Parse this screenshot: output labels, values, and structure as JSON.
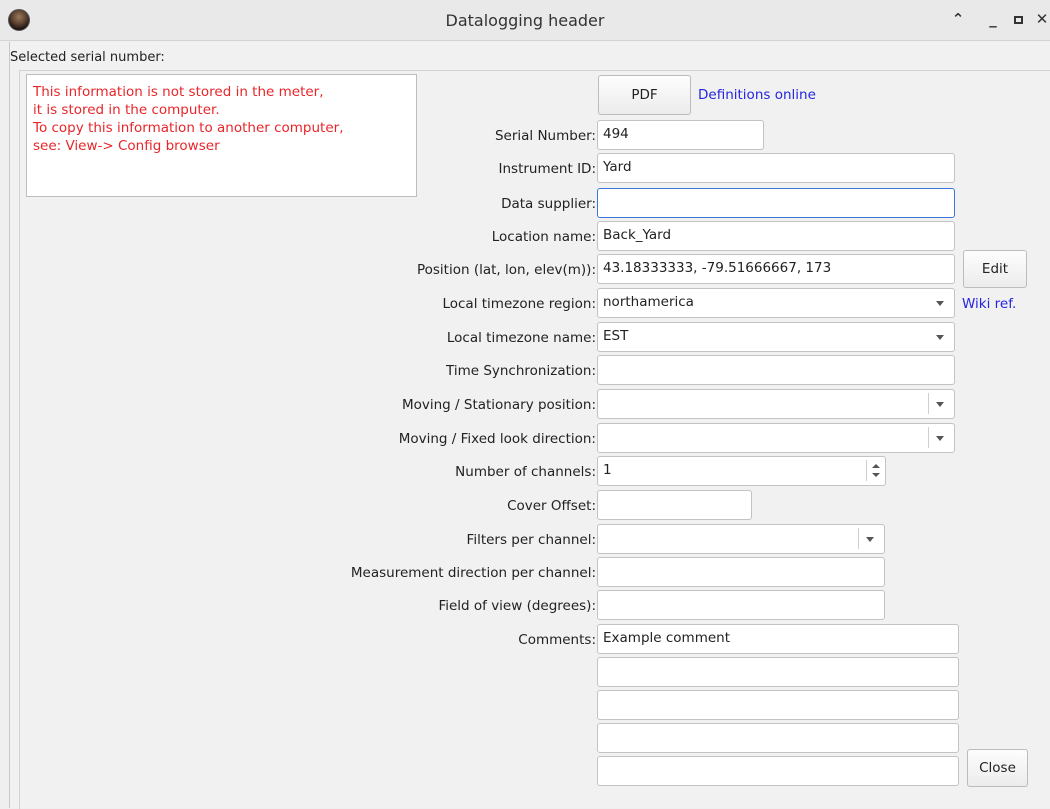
{
  "window": {
    "title": "Datalogging header"
  },
  "header": {
    "selected_label": "Selected serial number:"
  },
  "info": {
    "lines": [
      "This information is not stored in the meter,",
      "it is stored in the computer.",
      "To copy this information to another computer,",
      "see:  View-> Config browser"
    ],
    "color": "#e8262a"
  },
  "top": {
    "pdf_label": "PDF",
    "definitions_link": "Definitions online"
  },
  "form": {
    "serial_number": {
      "label": "Serial Number:",
      "value": "494"
    },
    "instrument_id": {
      "label": "Instrument ID:",
      "value": "Yard"
    },
    "data_supplier": {
      "label": "Data supplier:",
      "value": ""
    },
    "location_name": {
      "label": "Location name:",
      "value": "Back_Yard"
    },
    "position": {
      "label": "Position (lat, lon, elev(m)):",
      "value": "43.18333333, -79.51666667, 173",
      "edit_label": "Edit"
    },
    "tz_region": {
      "label": "Local timezone region:",
      "value": "northamerica",
      "link": "Wiki ref."
    },
    "tz_name": {
      "label": "Local timezone name:",
      "value": "EST"
    },
    "time_sync": {
      "label": "Time Synchronization:",
      "value": ""
    },
    "moving_position": {
      "label": "Moving / Stationary position:",
      "value": ""
    },
    "look_direction": {
      "label": "Moving / Fixed look direction:",
      "value": ""
    },
    "channels": {
      "label": "Number of channels:",
      "value": "1"
    },
    "cover_offset": {
      "label": "Cover Offset:",
      "value": ""
    },
    "filters": {
      "label": "Filters per channel:",
      "value": ""
    },
    "measurement_dir": {
      "label": "Measurement direction per channel:",
      "value": ""
    },
    "fov": {
      "label": "Field of view (degrees):",
      "value": ""
    },
    "comments": {
      "label": "Comments:",
      "lines": [
        "Example comment",
        "",
        "",
        "",
        ""
      ]
    }
  },
  "footer": {
    "close_label": "Close"
  },
  "colors": {
    "link": "#2525e0",
    "focus": "#3a7ad4"
  }
}
